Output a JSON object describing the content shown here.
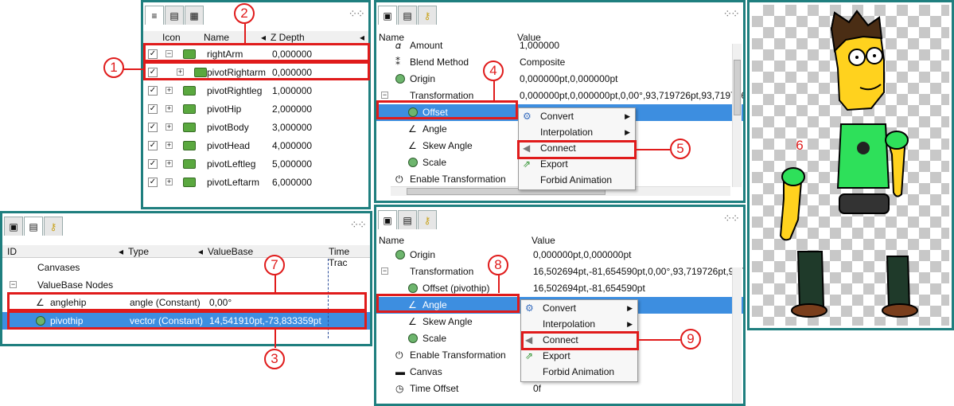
{
  "layers_panel": {
    "col_icon": "Icon",
    "col_name": "Name",
    "col_zdepth": "Z Depth",
    "rows": [
      {
        "name": "rightArm",
        "z": "0,000000"
      },
      {
        "name": "pivotRightarm",
        "z": "0,000000"
      },
      {
        "name": "pivotRightleg",
        "z": "1,000000"
      },
      {
        "name": "pivotHip",
        "z": "2,000000"
      },
      {
        "name": "pivotBody",
        "z": "3,000000"
      },
      {
        "name": "pivotHead",
        "z": "4,000000"
      },
      {
        "name": "pivotLeftleg",
        "z": "5,000000"
      },
      {
        "name": "pivotLeftarm",
        "z": "6,000000"
      }
    ]
  },
  "library_panel": {
    "col_id": "ID",
    "col_type": "Type",
    "col_valuebase": "ValueBase",
    "col_time": "Time Trac",
    "canvases": "Canvases",
    "valuebase_nodes": "ValueBase Nodes",
    "anglehip": {
      "name": "anglehip",
      "type": "angle (Constant)",
      "value": "0,00°"
    },
    "pivothip": {
      "name": "pivothip",
      "type": "vector (Constant)",
      "value": "14,541910pt,-73,833359pt"
    }
  },
  "params_top": {
    "col_name": "Name",
    "col_value": "Value",
    "rows": [
      {
        "name": "Amount",
        "value": "1,000000"
      },
      {
        "name": "Blend Method",
        "value": "Composite"
      },
      {
        "name": "Origin",
        "value": "0,000000pt,0,000000pt"
      },
      {
        "name": "Transformation",
        "value": "0,000000pt,0,000000pt,0,00°,93,719726pt,93,719726"
      },
      {
        "name": "Offset",
        "value": ""
      },
      {
        "name": "Angle",
        "value": ""
      },
      {
        "name": "Skew Angle",
        "value": ""
      },
      {
        "name": "Scale",
        "value": ""
      },
      {
        "name": "Enable Transformation",
        "value": ""
      }
    ]
  },
  "params_bottom": {
    "col_name": "Name",
    "col_value": "Value",
    "rows": [
      {
        "name": "Origin",
        "value": "0,000000pt,0,000000pt"
      },
      {
        "name": "Transformation",
        "value": "16,502694pt,-81,654590pt,0,00°,93,719726pt,93,7"
      },
      {
        "name": "Offset (pivothip)",
        "value": "16,502694pt,-81,654590pt"
      },
      {
        "name": "Angle",
        "value": ""
      },
      {
        "name": "Skew Angle",
        "value": ""
      },
      {
        "name": "Scale",
        "value": ""
      },
      {
        "name": "Enable Transformation",
        "value": ""
      },
      {
        "name": "Canvas",
        "value": ""
      },
      {
        "name": "Time Offset",
        "value": "0f"
      }
    ]
  },
  "context_menu": {
    "convert": "Convert",
    "interpolation": "Interpolation",
    "connect": "Connect",
    "export": "Export",
    "forbid": "Forbid Animation"
  },
  "callouts": [
    "1",
    "2",
    "3",
    "4",
    "5",
    "6",
    "7",
    "8",
    "9"
  ],
  "colors": {
    "accent_red": "#e01b1b",
    "panel_border": "#1f7f7f",
    "selection": "#3d8ee0"
  }
}
